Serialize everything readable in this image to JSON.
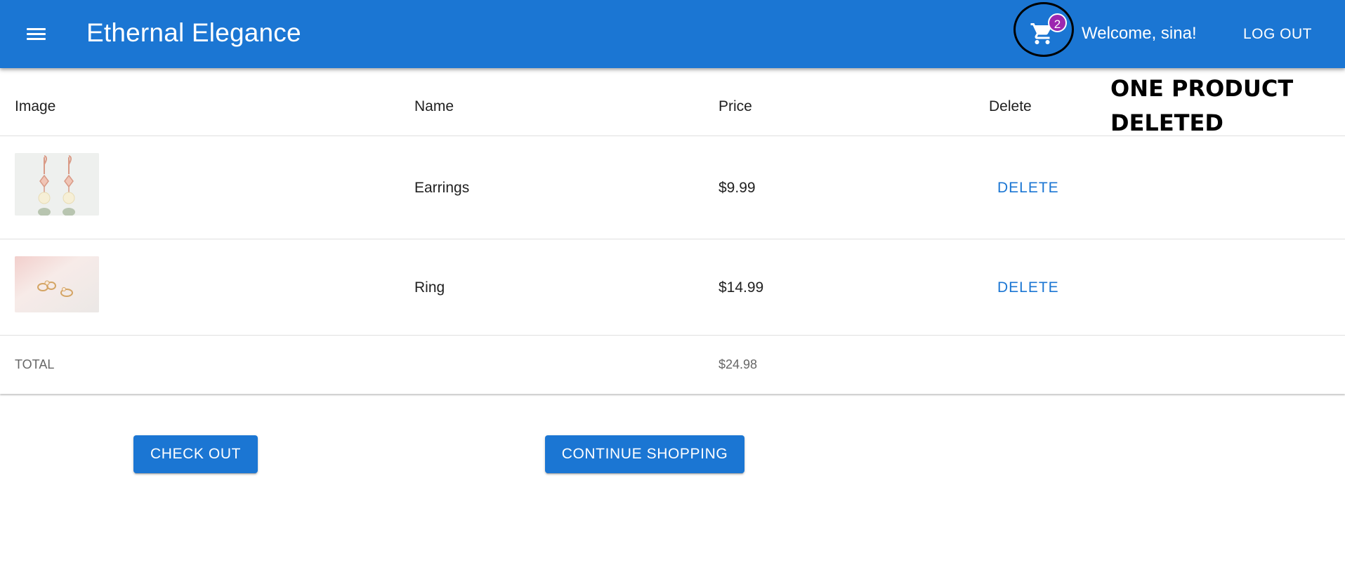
{
  "app": {
    "title": "Ethernal Elegance",
    "accent_color": "#1b76d3",
    "badge_color": "#9c27b0"
  },
  "header": {
    "menu_icon": "menu-icon",
    "cart_icon": "shopping-cart-icon",
    "cart_count": "2",
    "welcome_text": "Welcome, sina!",
    "logout_label": "LOG OUT"
  },
  "annotation": {
    "line1": "ONE PRODUCT",
    "line2": "DELETED"
  },
  "table": {
    "columns": [
      "Image",
      "Name",
      "Price",
      "Delete"
    ],
    "rows": [
      {
        "name": "Earrings",
        "price": "$9.99",
        "delete_label": "DELETE",
        "image": "earrings-image"
      },
      {
        "name": "Ring",
        "price": "$14.99",
        "delete_label": "DELETE",
        "image": "ring-image"
      }
    ],
    "total_label": "TOTAL",
    "total_value": "$24.98"
  },
  "actions": {
    "checkout_label": "CHECK OUT",
    "continue_label": "CONTINUE SHOPPING"
  }
}
